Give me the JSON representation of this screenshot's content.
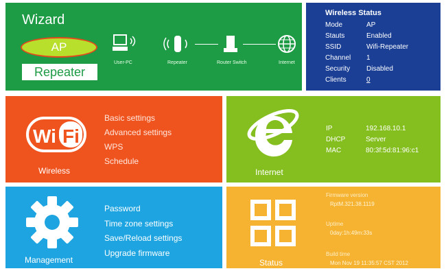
{
  "wizard": {
    "title": "Wizard",
    "ap_label": "AP",
    "repeater_label": "Repeater",
    "topology": {
      "user_pc": "User-PC",
      "repeater": "Repeater",
      "router": "Router Switch",
      "internet": "Internet"
    }
  },
  "wireless_status": {
    "title": "Wireless Status",
    "rows": [
      {
        "key": "Mode",
        "value": "AP"
      },
      {
        "key": "Stauts",
        "value": "Enabled"
      },
      {
        "key": "SSID",
        "value": "Wifi-Repeater"
      },
      {
        "key": "Channel",
        "value": "1"
      },
      {
        "key": "Security",
        "value": "Disabled"
      },
      {
        "key": "Clients",
        "value": "0"
      }
    ]
  },
  "wireless": {
    "label": "Wireless",
    "logo_text": "Wi Fi",
    "menu": [
      "Basic settings",
      "Advanced settings",
      "WPS",
      "Schedule"
    ]
  },
  "internet": {
    "label": "Internet",
    "rows": [
      {
        "key": "IP",
        "value": "192.168.10.1"
      },
      {
        "key": "DHCP",
        "value": "Server"
      },
      {
        "key": "MAC",
        "value": "80:3f:5d:81:96:c1"
      }
    ]
  },
  "management": {
    "label": "Management",
    "menu": [
      "Password",
      "Time zone settings",
      "Save/Reload settings",
      "Upgrade firmware"
    ]
  },
  "status": {
    "label": "Status",
    "firmware_key": "Firmware version",
    "firmware_value": "RptM.321.38.1119",
    "uptime_key": "Uptime",
    "uptime_value": "0day:1h:49m:33s",
    "build_key": "Build time",
    "build_value": "Mon Nov 19 11:35:57 CST 2012"
  },
  "colors": {
    "wizard": "#1d9b45",
    "wireless_status": "#1a3f95",
    "wireless": "#f0541e",
    "internet": "#85bf1f",
    "management": "#1ea5e1",
    "status": "#f6b331"
  }
}
